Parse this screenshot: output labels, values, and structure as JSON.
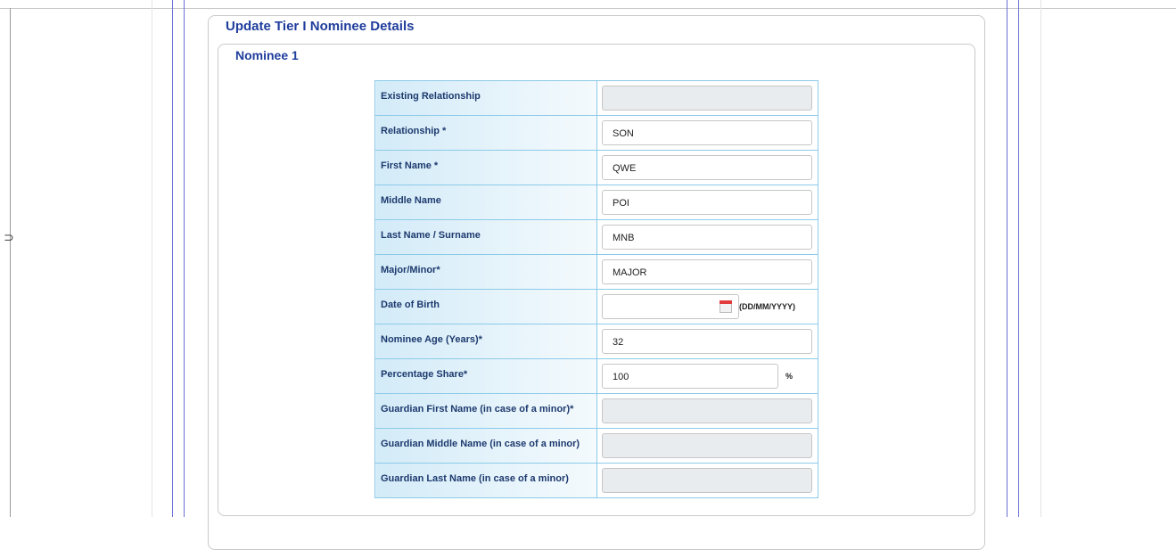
{
  "page": {
    "title": "Update Tier I Nominee Details",
    "section_title": "Nominee 1"
  },
  "form": {
    "rows": [
      {
        "label": "Existing Relationship",
        "value": "",
        "disabled": true
      },
      {
        "label": "Relationship *",
        "value": "SON",
        "disabled": false
      },
      {
        "label": "First Name *",
        "value": "QWE",
        "disabled": false
      },
      {
        "label": "Middle Name",
        "value": "POI",
        "disabled": false
      },
      {
        "label": "Last Name / Surname",
        "value": "MNB",
        "disabled": false
      },
      {
        "label": "Major/Minor*",
        "value": "MAJOR",
        "disabled": false
      },
      {
        "label": "Date of Birth",
        "value": "",
        "suffix": "(DD/MM/YYYY)",
        "icon": "calendar-icon"
      },
      {
        "label": "Nominee Age (Years)*",
        "value": "32",
        "disabled": false
      },
      {
        "label": "Percentage Share*",
        "value": "100",
        "suffix": "%"
      },
      {
        "label": "Guardian First Name (in case of a minor)*",
        "value": "",
        "disabled": true
      },
      {
        "label": "Guardian Middle Name (in case of a minor)",
        "value": "",
        "disabled": true
      },
      {
        "label": "Guardian Last Name (in case of a minor)",
        "value": "",
        "disabled": true
      }
    ]
  },
  "colors": {
    "title": "#1f3d9c",
    "label_text": "#1d3a6e",
    "table_border": "#8ccbe8",
    "frame_line": "#6b6fd6",
    "disabled_field": "#e9ecef"
  }
}
